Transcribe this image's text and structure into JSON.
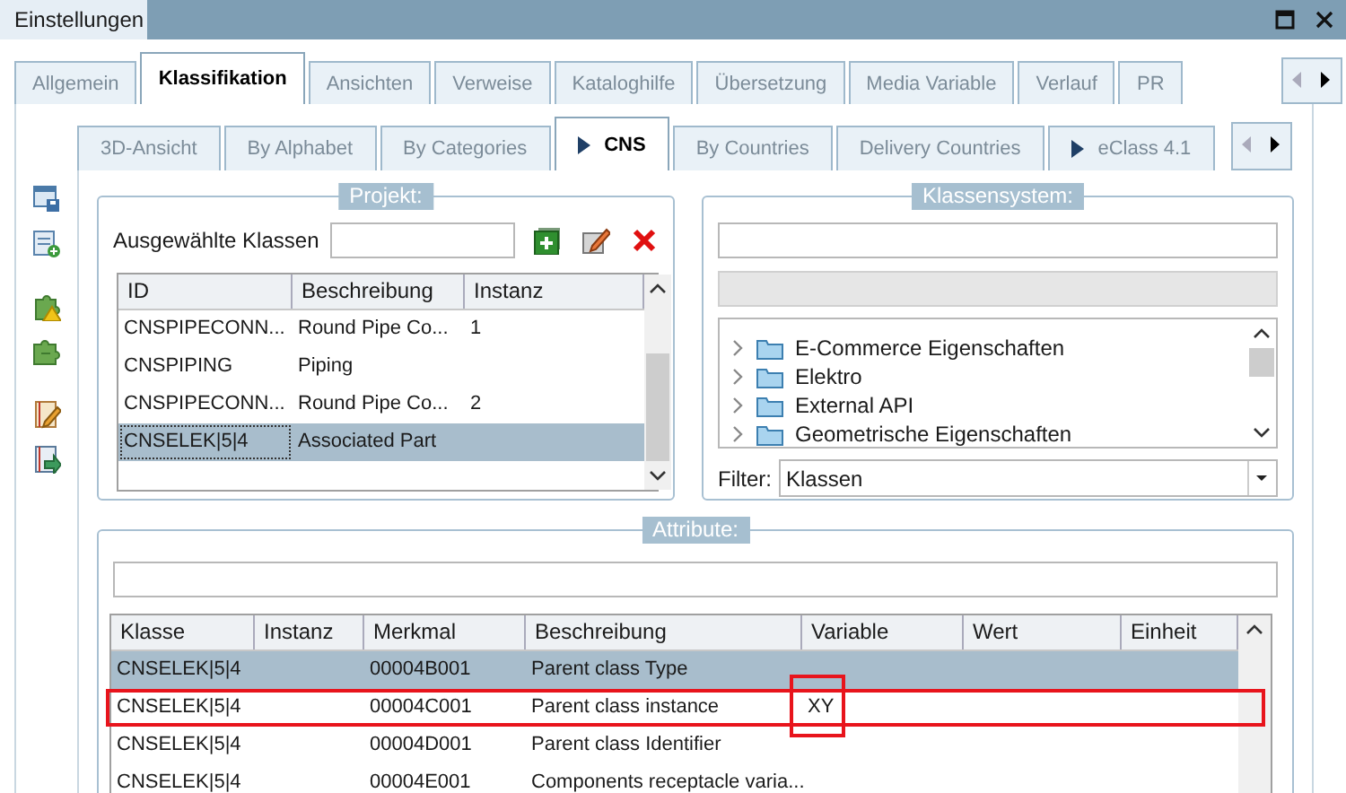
{
  "window": {
    "title": "Einstellungen"
  },
  "tabs": [
    {
      "label": "Allgemein",
      "selected": false
    },
    {
      "label": "Klassifikation",
      "selected": true
    },
    {
      "label": "Ansichten",
      "selected": false
    },
    {
      "label": "Verweise",
      "selected": false
    },
    {
      "label": "Kataloghilfe",
      "selected": false
    },
    {
      "label": "Übersetzung",
      "selected": false
    },
    {
      "label": "Media Variable",
      "selected": false
    },
    {
      "label": "Verlauf",
      "selected": false
    },
    {
      "label": "PR",
      "selected": false
    }
  ],
  "subtabs": [
    {
      "label": "3D-Ansicht",
      "selected": false,
      "marker": false
    },
    {
      "label": "By Alphabet",
      "selected": false,
      "marker": false
    },
    {
      "label": "By Categories",
      "selected": false,
      "marker": false
    },
    {
      "label": "CNS",
      "selected": true,
      "marker": true
    },
    {
      "label": "By Countries",
      "selected": false,
      "marker": false
    },
    {
      "label": "Delivery Countries",
      "selected": false,
      "marker": false
    },
    {
      "label": "eClass 4.1",
      "selected": false,
      "marker": true
    }
  ],
  "projekt": {
    "title": "Projekt:",
    "field_label": "Ausgewählte Klassen",
    "columns": [
      "ID",
      "Beschreibung",
      "Instanz"
    ],
    "rows": [
      {
        "cells": [
          "CNSPIPECONN...",
          "Round Pipe Co...",
          "1"
        ],
        "selected": false
      },
      {
        "cells": [
          "CNSPIPING",
          "Piping",
          ""
        ],
        "selected": false
      },
      {
        "cells": [
          "CNSPIPECONN...",
          "Round Pipe Co...",
          "2"
        ],
        "selected": false
      },
      {
        "cells": [
          "CNSELEK|5|4",
          "Associated Part",
          ""
        ],
        "selected": true
      }
    ]
  },
  "klassensystem": {
    "title": "Klassensystem:",
    "tree": [
      {
        "label": "E-Commerce Eigenschaften",
        "expanded": false
      },
      {
        "label": "Elektro",
        "expanded": false
      },
      {
        "label": "External API",
        "expanded": false
      },
      {
        "label": "Geometrische Eigenschaften",
        "expanded": false
      }
    ],
    "filter_label": "Filter:",
    "filter_value": "Klassen"
  },
  "attribute": {
    "title": "Attribute:",
    "columns": [
      "Klasse",
      "Instanz",
      "Merkmal",
      "Beschreibung",
      "Variable",
      "Wert",
      "Einheit"
    ],
    "rows": [
      {
        "cells": [
          "CNSELEK|5|4",
          "",
          "00004B001",
          "Parent class Type",
          "",
          "",
          ""
        ],
        "selected": true,
        "highlighted": false,
        "variable_marked": false
      },
      {
        "cells": [
          "CNSELEK|5|4",
          "",
          "00004C001",
          "Parent class instance",
          "XY",
          "",
          ""
        ],
        "selected": false,
        "highlighted": true,
        "variable_marked": true
      },
      {
        "cells": [
          "CNSELEK|5|4",
          "",
          "00004D001",
          "Parent class Identifier",
          "",
          "",
          ""
        ],
        "selected": false,
        "highlighted": false,
        "variable_marked": false
      },
      {
        "cells": [
          "CNSELEK|5|4",
          "",
          "00004E001",
          "Components receptacle varia...",
          "",
          "",
          ""
        ],
        "selected": false,
        "highlighted": false,
        "variable_marked": false
      }
    ]
  }
}
